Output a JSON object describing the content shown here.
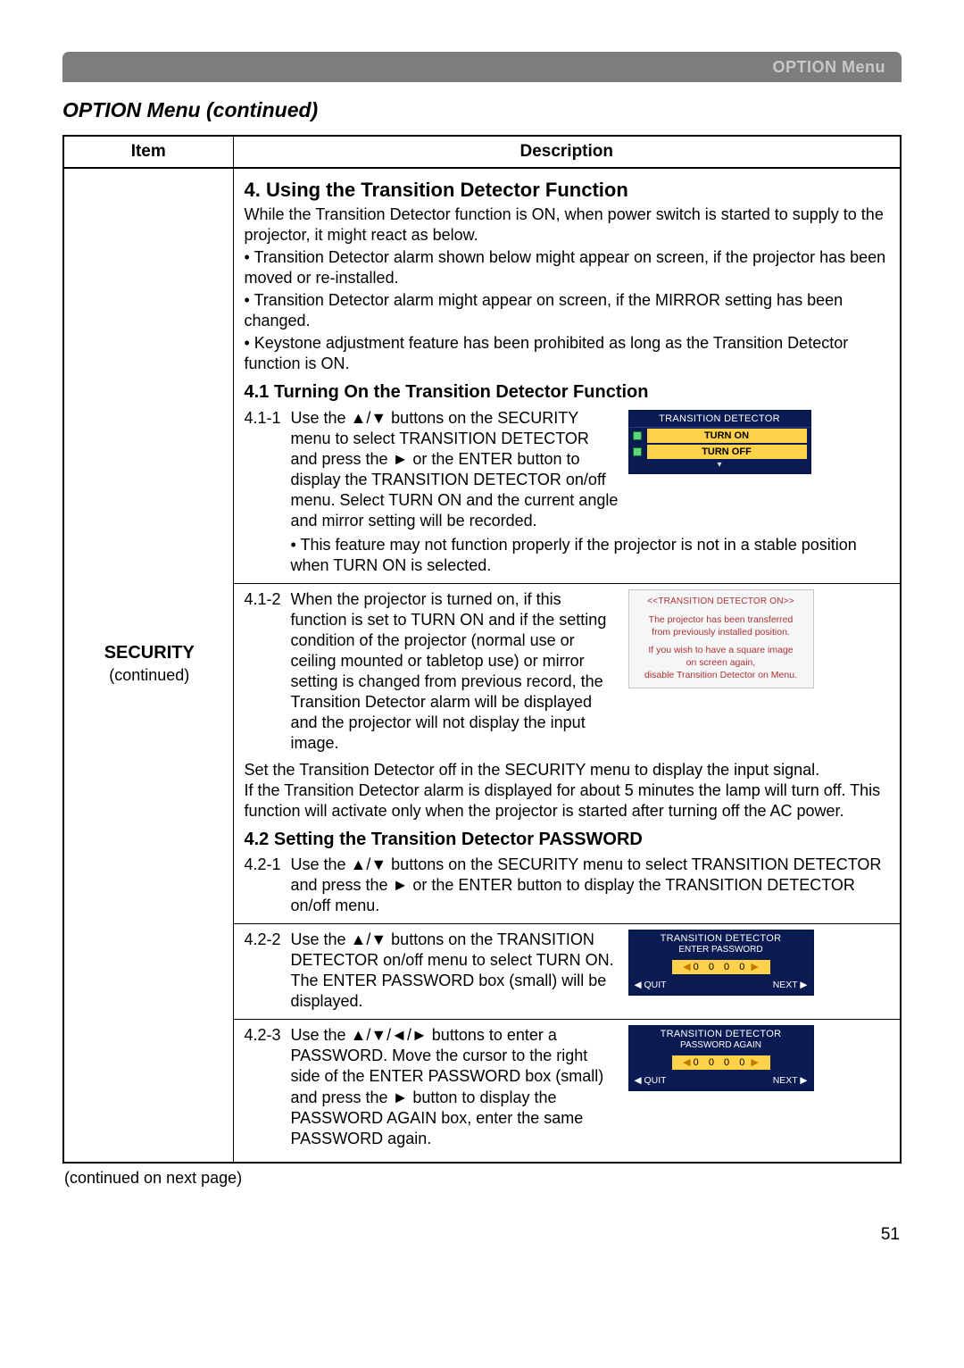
{
  "header": {
    "topbar": "OPTION Menu"
  },
  "page": {
    "title": "OPTION Menu (continued)",
    "colItem": "Item",
    "colDesc": "Description",
    "continued": "(continued on next page)",
    "number": "51"
  },
  "item": {
    "name": "SECURITY",
    "suffix": "(continued)"
  },
  "desc": {
    "h4": "4. Using the Transition Detector Function",
    "p1": "While the Transition Detector function is ON, when power switch is started to supply to the projector, it might react as below.",
    "p1b1": "• Transition Detector alarm shown below might appear on screen, if the projector has been moved or re-installed.",
    "p1b2": "• Transition Detector alarm might appear on screen, if the MIRROR setting has been changed.",
    "p1b3": "• Keystone adjustment feature has been prohibited as long as the Transition Detector function is ON.",
    "h41": "4.1 Turning On the Transition Detector Function",
    "s411num": "4.1-1",
    "s411": "Use the ▲/▼ buttons on the SECURITY menu to select TRANSITION DETECTOR and press the ► or the ENTER button to display the TRANSITION DETECTOR on/off menu. Select TURN ON and the current angle and mirror setting will be recorded.",
    "s411note": "• This feature may not function properly if the projector is not in a stable position when TURN ON is selected.",
    "s412num": "4.1-2",
    "s412": "When the projector is turned on, if this function is set to TURN ON and if the setting condition of the projector (normal use or ceiling mounted or tabletop use) or mirror setting is changed from previous record, the Transition Detector alarm will be displayed and the projector will not display the input image.",
    "s41post1": "Set the Transition Detector off in the SECURITY menu to display the input signal.",
    "s41post2": "If the Transition Detector alarm is displayed for about 5 minutes the lamp will turn off. This function will activate only when the projector is started after turning off the AC power.",
    "h42": "4.2 Setting the Transition Detector PASSWORD",
    "s421num": "4.2-1",
    "s421": "Use the ▲/▼ buttons on the SECURITY menu to select TRANSITION DETECTOR and press the ► or the ENTER button to display the TRANSITION DETECTOR on/off menu.",
    "s422num": "4.2-2",
    "s422": "Use the ▲/▼ buttons on the TRANSITION DETECTOR on/off menu to select TURN ON. The ENTER PASSWORD box (small) will be displayed.",
    "s423num": "4.2-3",
    "s423": "Use the ▲/▼/◄/► buttons to enter a PASSWORD. Move the cursor to the right side of the ENTER PASSWORD box (small) and press the ► button to display the PASSWORD AGAIN box, enter the same PASSWORD again."
  },
  "osd": {
    "menuTitle": "TRANSITION DETECTOR",
    "turnOn": "TURN ON",
    "turnOff": "TURN OFF",
    "alarmTitle": "<<TRANSITION DETECTOR ON>>",
    "alarmL1": "The projector has been transferred",
    "alarmL2": "from previously installed position.",
    "alarmL3": "If you wish to have a square image",
    "alarmL4": "on screen again,",
    "alarmL5": "disable Transition Detector on Menu.",
    "passTitle": "TRANSITION DETECTOR",
    "enterPass": "ENTER PASSWORD",
    "passAgain": "PASSWORD AGAIN",
    "digits": "0 0 0 0",
    "quit": "◀ QUIT",
    "next": "NEXT ▶"
  }
}
